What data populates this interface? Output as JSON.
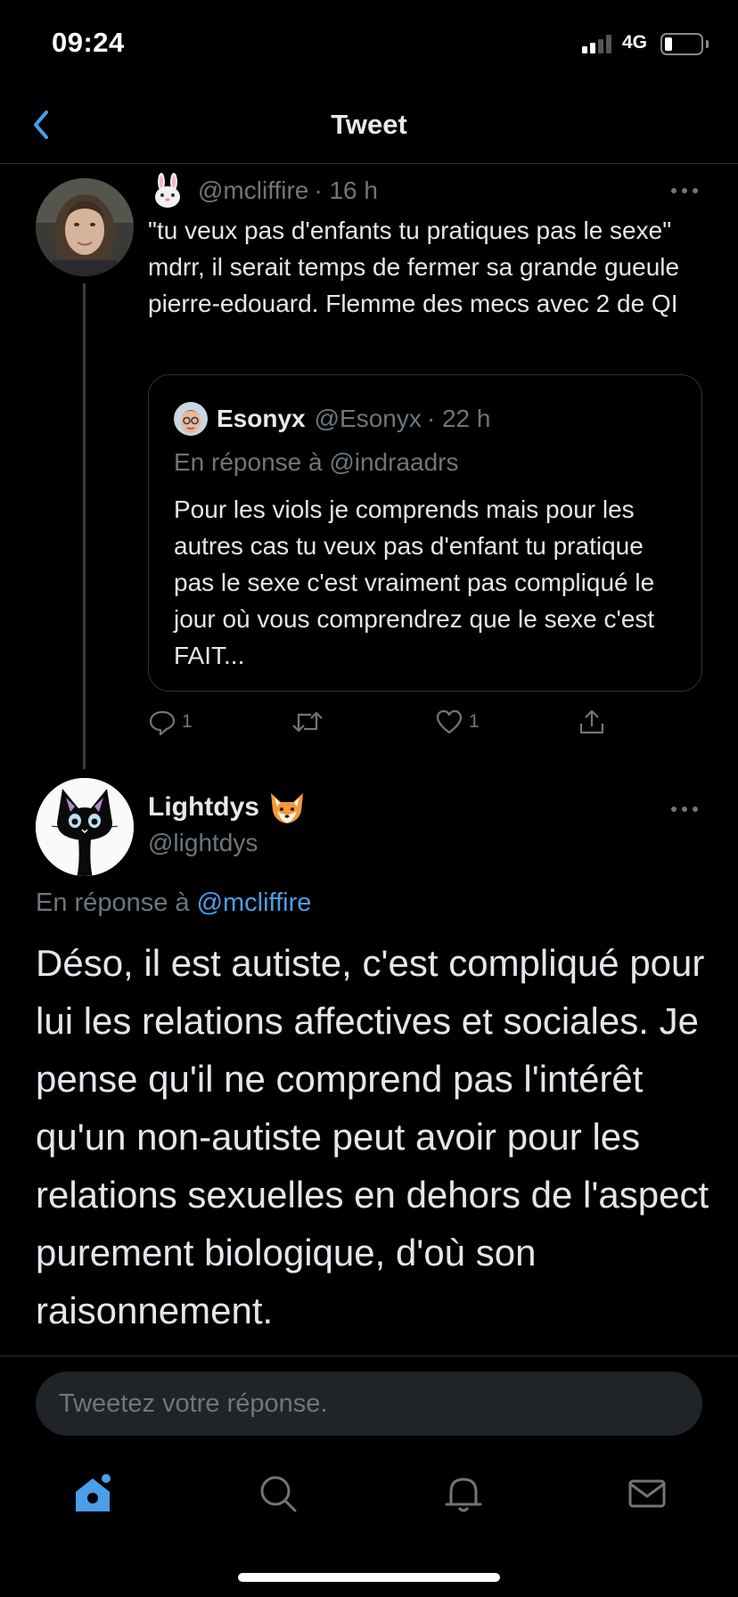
{
  "status_bar": {
    "time": "09:24",
    "network": "4G"
  },
  "header": {
    "title": "Tweet"
  },
  "tweet1": {
    "handle": "@mcliffire",
    "time": "· 16 h",
    "text": "\"tu veux pas d'enfants tu pratiques pas le sexe\" mdrr, il serait temps de fermer sa grande gueule pierre-edouard. Flemme des mecs avec 2 de QI",
    "quote": {
      "name": "Esonyx",
      "handle": "@Esonyx",
      "time": "· 22 h",
      "reply_to": "En réponse à @indraadrs",
      "text": "Pour les viols je comprends mais pour les autres cas tu veux pas d'enfant tu pratique pas le sexe c'est vraiment pas compliqué le jour où vous comprendrez que le sexe c'est FAIT..."
    },
    "actions": {
      "replies": "1",
      "likes": "1"
    }
  },
  "tweet2": {
    "name": "Lightdys",
    "handle": "@lightdys",
    "reply_prefix": "En réponse à ",
    "reply_to": "@mcliffire",
    "text": "Déso, il est autiste, c'est compliqué pour lui les relations affectives et sociales. Je pense qu'il ne comprend pas l'intérêt qu'un non-autiste peut avoir pour les relations sexuelles en dehors de l'aspect purement biologique, d'où son raisonnement."
  },
  "composer": {
    "placeholder": "Tweetez votre réponse."
  },
  "tabs": [
    {
      "icon": "home-icon",
      "active": true
    },
    {
      "icon": "search-icon",
      "active": false
    },
    {
      "icon": "bell-icon",
      "active": false
    },
    {
      "icon": "mail-icon",
      "active": false
    }
  ],
  "colors": {
    "accent": "#4a9fe8",
    "background": "#000000",
    "muted": "#6e767d"
  }
}
